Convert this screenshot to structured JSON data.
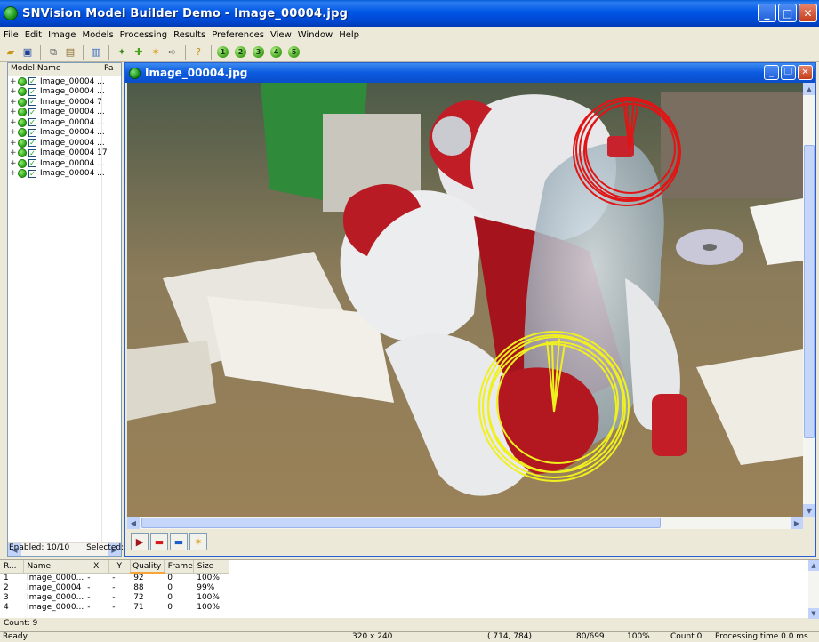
{
  "window": {
    "title": "SNVision Model Builder Demo - Image_00004.jpg"
  },
  "menu": [
    "File",
    "Edit",
    "Image",
    "Models",
    "Processing",
    "Results",
    "Preferences",
    "View",
    "Window",
    "Help"
  ],
  "toolbar": {
    "numbered_buttons": [
      "1",
      "2",
      "3",
      "4",
      "5"
    ]
  },
  "model_panel": {
    "col_name": "Model Name",
    "col_pa": "Pa",
    "items": [
      "Image_00004 ...",
      "Image_00004 ...",
      "Image_00004 7",
      "Image_00004 ...",
      "Image_00004 ...",
      "Image_00004 ...",
      "Image_00004 ...",
      "Image_00004 17",
      "Image_00004 ...",
      "Image_00004 ..."
    ],
    "enabled": "Enabled: 10/10",
    "selected": "Selected:"
  },
  "image_window": {
    "title": "Image_00004.jpg"
  },
  "results": {
    "headers": [
      "R...",
      "Name",
      "X",
      "Y",
      "Quality",
      "Frame",
      "Size"
    ],
    "rows": [
      [
        "1",
        "Image_0000...",
        "-",
        "-",
        "92",
        "0",
        "100%"
      ],
      [
        "2",
        "Image_00004",
        "-",
        "-",
        "88",
        "0",
        "99%"
      ],
      [
        "3",
        "Image_0000...",
        "-",
        "-",
        "72",
        "0",
        "100%"
      ],
      [
        "4",
        "Image_0000...",
        "-",
        "-",
        "71",
        "0",
        "100%"
      ]
    ],
    "count": "Count: 9"
  },
  "status": {
    "ready": "Ready",
    "resolution": "320 x 240",
    "coords": "( 714, 784)",
    "frame": "80/699",
    "zoom": "100%",
    "count": "Count 0",
    "processing": "Processing time  0.0 ms"
  },
  "colors": {
    "match_red": "#e01515",
    "match_yellow": "#f0f020",
    "title_blue": "#0055e5"
  }
}
